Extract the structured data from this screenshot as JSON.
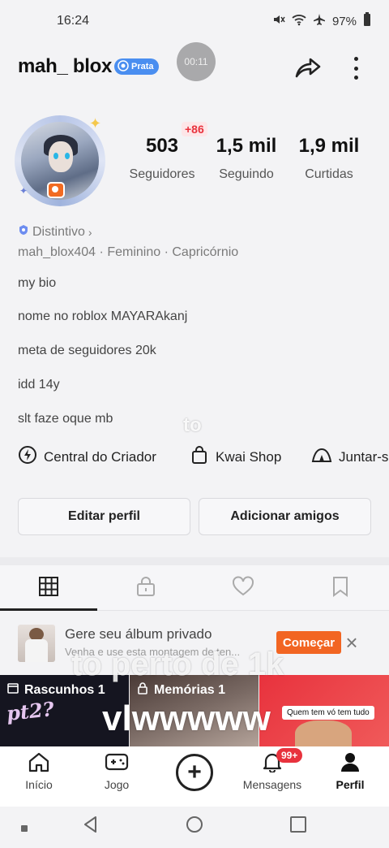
{
  "status_bar": {
    "time": "16:24",
    "battery": "97%",
    "icons": [
      "mute-icon",
      "wifi-icon",
      "airplane-icon",
      "battery-icon"
    ]
  },
  "header": {
    "username": "mah_ blox",
    "badge_label": "Prata",
    "recording_time": "00:11",
    "icons": [
      "share-icon",
      "more-icon"
    ]
  },
  "stats": {
    "new_followers": "+86",
    "items": [
      {
        "value": "503",
        "label": "Seguidores"
      },
      {
        "value": "1,5 mil",
        "label": "Seguindo"
      },
      {
        "value": "1,9 mil",
        "label": "Curtidas"
      }
    ]
  },
  "profile": {
    "distintivo": "Distintivo",
    "handle": "mah_blox404",
    "gender": "Feminino",
    "sign": "Capricórnio",
    "bio": [
      "my bio",
      "nome no roblox MAYARAkanj",
      "meta de seguidores 20k",
      "idd 14y",
      "slt faze oque mb"
    ]
  },
  "links": [
    {
      "label": "Central do Criador",
      "icon": "lightning-icon"
    },
    {
      "label": "Kwai Shop",
      "icon": "shopping-bag-icon"
    },
    {
      "label": "Juntar-s",
      "icon": "tent-icon"
    }
  ],
  "actions": {
    "edit": "Editar perfil",
    "add_friends": "Adicionar amigos"
  },
  "tabs": [
    "grid-icon",
    "lock-icon",
    "heart-icon",
    "bookmark-icon"
  ],
  "promo": {
    "title": "Gere seu álbum privado",
    "subtitle": "Venha e use esta montagem de ten...",
    "button": "Começar"
  },
  "grid": {
    "drafts": "Rascunhos 1",
    "memories": "Memórias 1",
    "draft_sticker": "pt2?",
    "meme_caption": "Quem tem vó tem tudo"
  },
  "overlays": {
    "line1": "to",
    "line2": "to perto de 1k",
    "line3": "vlwwwww"
  },
  "bottom_nav": {
    "items": [
      {
        "label": "Início",
        "icon": "home-icon"
      },
      {
        "label": "Jogo",
        "icon": "gamepad-icon"
      },
      {
        "label": "",
        "icon": "plus-circle-icon"
      },
      {
        "label": "Mensagens",
        "icon": "bell-icon"
      },
      {
        "label": "Perfil",
        "icon": "person-icon"
      }
    ],
    "message_badge": "99+"
  },
  "colors": {
    "accent_orange": "#f26522",
    "badge_red": "#e8323d",
    "prata_blue": "#4a8ef0"
  }
}
